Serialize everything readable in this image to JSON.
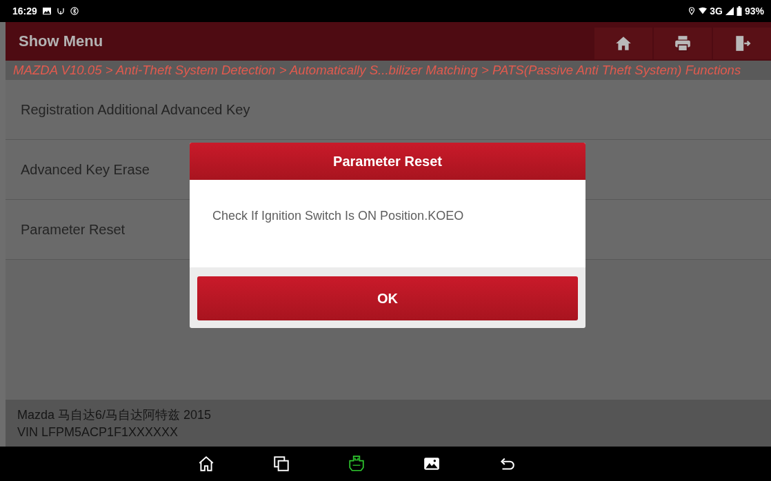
{
  "status_bar": {
    "time": "16:29",
    "network": "3G",
    "battery": "93%"
  },
  "header": {
    "title": "Show Menu",
    "buttons": [
      {
        "kind": "home"
      },
      {
        "kind": "print"
      },
      {
        "kind": "exit"
      }
    ]
  },
  "breadcrumb": "MAZDA V10.05 > Anti-Theft System Detection > Automatically S...bilizer Matching > PATS(Passive Anti Theft System) Functions",
  "menu_items": [
    {
      "label": "Registration Additional Advanced Key"
    },
    {
      "label": "Advanced Key Erase"
    },
    {
      "label": "Parameter Reset"
    }
  ],
  "dialog": {
    "title": "Parameter Reset",
    "message": "Check If Ignition Switch Is ON Position.KOEO",
    "button": "OK"
  },
  "vehicle": {
    "model": "Mazda 马自达6/马自达阿特兹 2015",
    "vin": "VIN LFPM5ACP1F1XXXXXX"
  },
  "nav_bar": [
    {
      "kind": "home"
    },
    {
      "kind": "recents"
    },
    {
      "kind": "vci"
    },
    {
      "kind": "gallery"
    },
    {
      "kind": "back"
    }
  ]
}
